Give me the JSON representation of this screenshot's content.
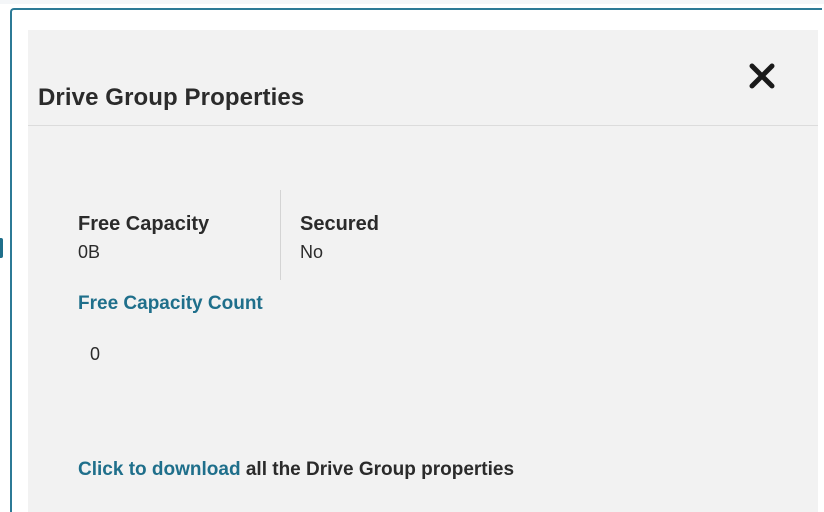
{
  "dialog": {
    "title": "Drive Group Properties",
    "close_icon": "close-icon"
  },
  "properties": {
    "free_capacity": {
      "label": "Free Capacity",
      "value": "0B"
    },
    "secured": {
      "label": "Secured",
      "value": "No"
    }
  },
  "free_capacity_count": {
    "label": "Free Capacity Count",
    "value": "0"
  },
  "download": {
    "link_text": "Click to download",
    "rest_text": "all the Drive Group properties"
  },
  "colors": {
    "accent": "#1f6f8b",
    "panel_background": "#f2f2f2",
    "text": "#2b2b2b"
  }
}
